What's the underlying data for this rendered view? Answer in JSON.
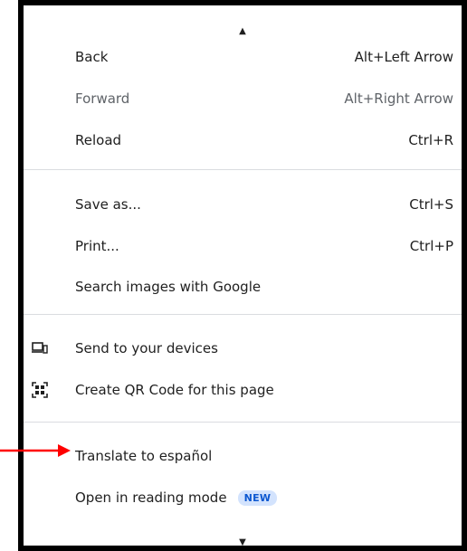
{
  "menu": {
    "groups": [
      [
        {
          "label": "Back",
          "shortcut": "Alt+Left Arrow"
        },
        {
          "label": "Forward",
          "shortcut": "Alt+Right Arrow"
        },
        {
          "label": "Reload",
          "shortcut": "Ctrl+R"
        }
      ],
      [
        {
          "label": "Save as...",
          "shortcut": "Ctrl+S"
        },
        {
          "label": "Print...",
          "shortcut": "Ctrl+P"
        },
        {
          "label": "Search images with Google"
        }
      ],
      [
        {
          "label": "Send to your devices",
          "icon": "devices-icon"
        },
        {
          "label": "Create QR Code for this page",
          "icon": "qr-code-icon"
        }
      ],
      [
        {
          "label": "Translate to español"
        },
        {
          "label": "Open in reading mode",
          "badge": "NEW"
        }
      ]
    ],
    "scroll_up_icon": "caret-up-icon",
    "scroll_down_icon": "caret-down-icon",
    "badge_color": "#d3e3fd",
    "badge_text_color": "#0b57d0",
    "annotation_arrow_color": "#ff0000"
  }
}
